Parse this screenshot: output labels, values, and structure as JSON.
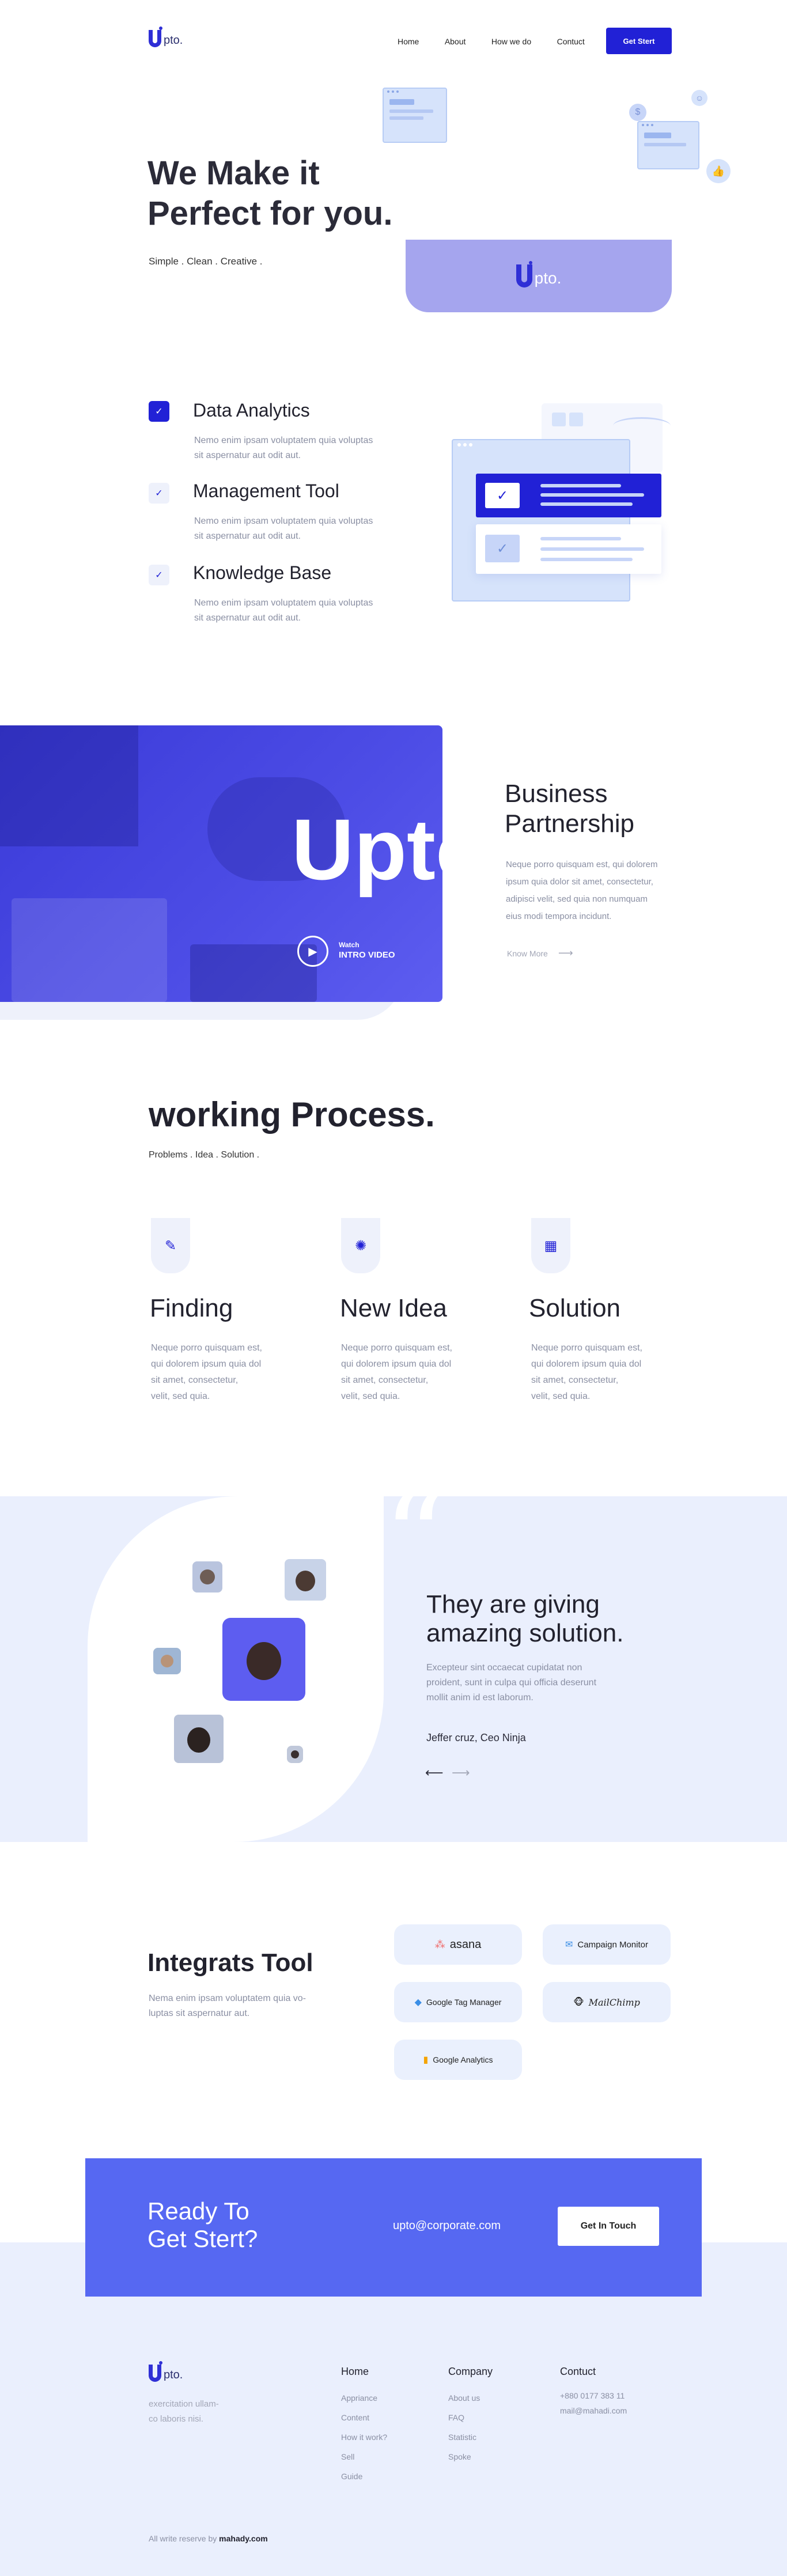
{
  "nav": {
    "logo_text": "pto.",
    "links": [
      "Home",
      "About",
      "How we do",
      "Contuct"
    ],
    "cta": "Get Stert"
  },
  "hero": {
    "title_line1": "We Make it",
    "title_line2": "Perfect for you.",
    "subtitle": "Simple . Clean . Creative .",
    "card_logo_text": "pto."
  },
  "features": {
    "items": [
      {
        "title": "Data Analytics",
        "desc_line1": "Nemo enim ipsam voluptatem quia voluptas",
        "desc_line2": "sit aspernatur aut odit aut."
      },
      {
        "title": "Management Tool",
        "desc_line1": "Nemo enim ipsam voluptatem quia voluptas",
        "desc_line2": "sit aspernatur aut odit aut."
      },
      {
        "title": "Knowledge Base",
        "desc_line1": "Nemo enim ipsam voluptatem quia voluptas",
        "desc_line2": "sit aspernatur aut odit aut."
      }
    ]
  },
  "video": {
    "big_text": "Upto",
    "watch": "Watch",
    "intro": "INTRO VIDEO",
    "title_line1": "Business",
    "title_line2": "Partnership",
    "desc_lines": [
      "Neque porro quisquam est, qui dolorem",
      "ipsum quia dolor sit amet, consectetur,",
      "adipisci velit, sed quia non numquam",
      "eius modi tempora incidunt."
    ],
    "know_more": "Know More"
  },
  "process": {
    "title": "working Process.",
    "subtitle": "Problems . Idea . Solution .",
    "items": [
      {
        "title": "Finding",
        "desc": [
          "Neque porro quisquam est,",
          "qui dolorem ipsum quia dol",
          "sit amet, consectetur,",
          "velit, sed quia."
        ]
      },
      {
        "title": "New Idea",
        "desc": [
          "Neque porro quisquam est,",
          "qui dolorem ipsum quia dol",
          "sit amet, consectetur,",
          "velit, sed quia."
        ]
      },
      {
        "title": "Solution",
        "desc": [
          "Neque porro quisquam est,",
          "qui dolorem ipsum quia dol",
          "sit amet, consectetur,",
          "velit, sed quia."
        ]
      }
    ]
  },
  "testimonial": {
    "title_line1": "They are giving",
    "title_line2": "amazing solution.",
    "desc_lines": [
      "Excepteur sint occaecat cupidatat non",
      "proident, sunt in culpa qui officia deserunt",
      "mollit anim id est laborum."
    ],
    "name": "Jeffer  cruz, Ceo Ninja"
  },
  "integrations": {
    "title": "Integrats Tool",
    "desc_line1": "Nema enim ipsam voluptatem quia vo-",
    "desc_line2": "luptas sit aspernatur aut.",
    "tools": [
      "asana",
      "Campaign Monitor",
      "Google Tag Manager",
      "MailChimp",
      "Google Analytics"
    ]
  },
  "cta": {
    "title_line1": "Ready To",
    "title_line2": "Get Stert?",
    "email": "upto@corporate.com",
    "button": "Get In Touch"
  },
  "footer": {
    "logo_text": "pto.",
    "desc_line1": "exercitation ullam-",
    "desc_line2": "co laboris nisi.",
    "columns": [
      {
        "head": "Home",
        "links": [
          "Appriance",
          "Content",
          "How it work?",
          "Sell",
          "Guide"
        ]
      },
      {
        "head": "Company",
        "links": [
          "About us",
          "FAQ",
          "Statistic",
          "Spoke"
        ]
      },
      {
        "head": "Contuct",
        "links": [
          "+880 0177 383 11",
          "mail@mahadi.com"
        ]
      }
    ],
    "copyright_prefix": "All write reserve by",
    "copyright_brand": "mahady.com"
  },
  "colors": {
    "primary": "#2121d6",
    "accent_light": "#eaeffd",
    "cta": "#5668f2"
  }
}
